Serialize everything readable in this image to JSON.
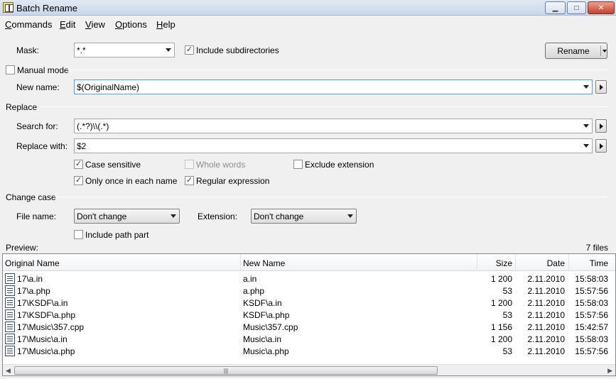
{
  "window": {
    "title": "Batch Rename",
    "minimize_glyph": "▁",
    "maximize_glyph": "□",
    "close_glyph": "✕"
  },
  "menu": [
    "Commands",
    "Edit",
    "View",
    "Options",
    "Help"
  ],
  "mask": {
    "label": "Mask:",
    "value": "*.*",
    "include_subdirectories_label": "Include subdirectories",
    "include_subdirectories_checked": true
  },
  "rename_button_label": "Rename",
  "manual_mode": {
    "label": "Manual mode",
    "checked": false
  },
  "new_name": {
    "label": "New name:",
    "value": "$(OriginalName)"
  },
  "replace": {
    "section_label": "Replace",
    "search_label": "Search for:",
    "search_value": "(.*?)\\\\(.*)",
    "replace_label": "Replace with:",
    "replace_value": "$2",
    "options": {
      "case_sensitive": {
        "label": "Case sensitive",
        "checked": true
      },
      "whole_words": {
        "label": "Whole words",
        "checked": false,
        "disabled": true
      },
      "exclude_extension": {
        "label": "Exclude extension",
        "checked": false
      },
      "only_once": {
        "label": "Only once in each name",
        "checked": true
      },
      "regular_expression": {
        "label": "Regular expression",
        "checked": true
      }
    }
  },
  "change_case": {
    "section_label": "Change case",
    "file_name_label": "File name:",
    "file_name_value": "Don't change",
    "extension_label": "Extension:",
    "extension_value": "Don't change",
    "include_path_label": "Include path part",
    "include_path_checked": false
  },
  "preview": {
    "label": "Preview:",
    "count": "7 files",
    "columns": [
      "Original Name",
      "New Name",
      "Size",
      "Date",
      "Time"
    ],
    "rows": [
      {
        "original": "17\\a.in",
        "new": "a.in",
        "size": "1 200",
        "date": "2.11.2010",
        "time": "15:58:03"
      },
      {
        "original": "17\\a.php",
        "new": "a.php",
        "size": "53",
        "date": "2.11.2010",
        "time": "15:57:56"
      },
      {
        "original": "17\\KSDF\\a.in",
        "new": "KSDF\\a.in",
        "size": "1 200",
        "date": "2.11.2010",
        "time": "15:58:03"
      },
      {
        "original": "17\\KSDF\\a.php",
        "new": "KSDF\\a.php",
        "size": "53",
        "date": "2.11.2010",
        "time": "15:57:56"
      },
      {
        "original": "17\\Music\\357.cpp",
        "new": "Music\\357.cpp",
        "size": "1 156",
        "date": "2.11.2010",
        "time": "15:42:57"
      },
      {
        "original": "17\\Music\\a.in",
        "new": "Music\\a.in",
        "size": "1 200",
        "date": "2.11.2010",
        "time": "15:58:03"
      },
      {
        "original": "17\\Music\\a.php",
        "new": "Music\\a.php",
        "size": "53",
        "date": "2.11.2010",
        "time": "15:57:56"
      }
    ],
    "scroll_grip": "|||"
  },
  "check_glyph": "✓",
  "icons": {
    "app": "batch-rename-icon",
    "dropdown": "chevron-down-icon",
    "insert": "triangle-right-icon",
    "file": "file-icon"
  }
}
